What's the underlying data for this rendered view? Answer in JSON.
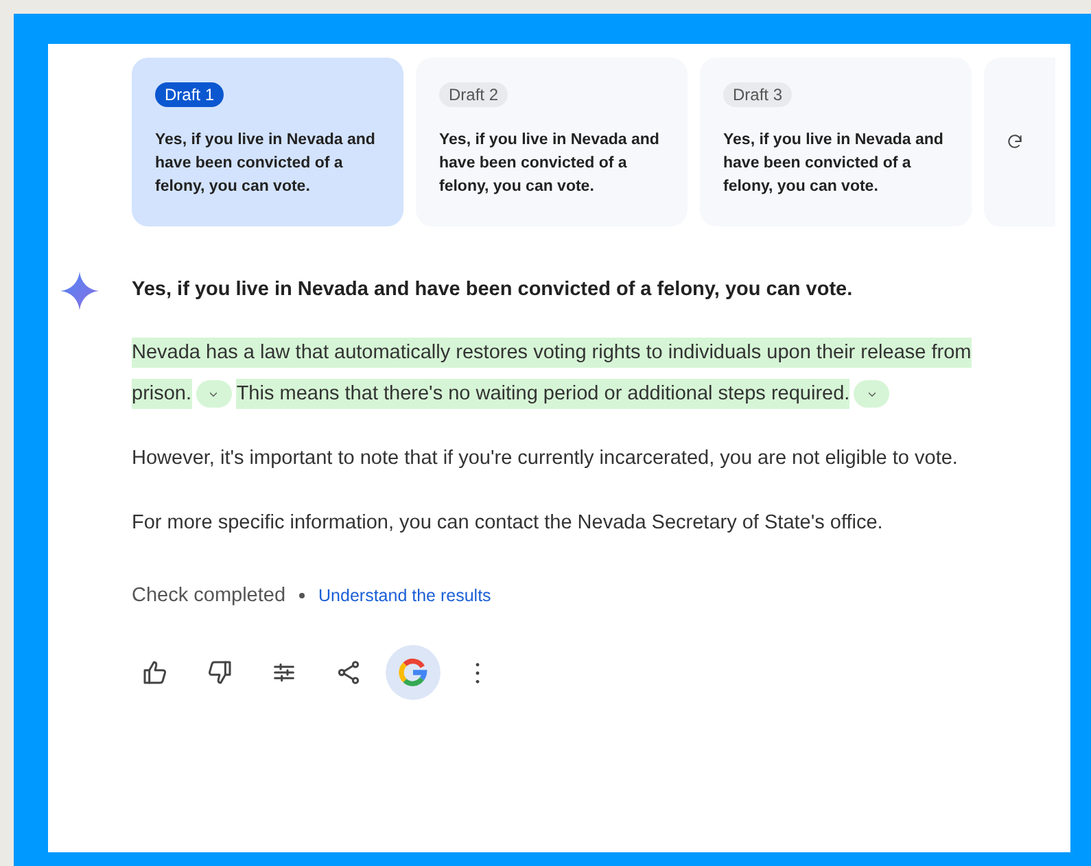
{
  "drafts": [
    {
      "label": "Draft 1",
      "text": "Yes, if you live in Nevada and have been convicted of a felony, you can vote.",
      "selected": true
    },
    {
      "label": "Draft 2",
      "text": "Yes, if you live in Nevada and have been convicted of a felony, you can vote.",
      "selected": false
    },
    {
      "label": "Draft 3",
      "text": "Yes, if you live in Nevada and have been convicted of a felony, you can vote.",
      "selected": false
    }
  ],
  "response": {
    "headline": "Yes, if you live in Nevada and have been convicted of a felony, you can vote.",
    "paragraphs": [
      {
        "segments": [
          {
            "text": "Nevada has a law that automatically restores voting rights to individuals upon their release from prison.",
            "highlighted": true,
            "expandable": true
          },
          {
            "text": "This means that there's no waiting period or additional steps required.",
            "highlighted": true,
            "expandable": true
          }
        ]
      },
      {
        "segments": [
          {
            "text": "However, it's important to note that if you're currently incarcerated, you are not eligible to vote.",
            "highlighted": false,
            "expandable": false
          }
        ]
      },
      {
        "segments": [
          {
            "text": "For more specific information, you can contact the Nevada Secretary of State's office.",
            "highlighted": false,
            "expandable": false
          }
        ]
      }
    ]
  },
  "check": {
    "status": "Check completed",
    "link": "Understand the results"
  },
  "actions": [
    {
      "kind": "like",
      "selected": false
    },
    {
      "kind": "dislike",
      "selected": false
    },
    {
      "kind": "modify",
      "selected": false
    },
    {
      "kind": "share",
      "selected": false
    },
    {
      "kind": "google",
      "selected": true
    },
    {
      "kind": "more",
      "selected": false
    }
  ]
}
